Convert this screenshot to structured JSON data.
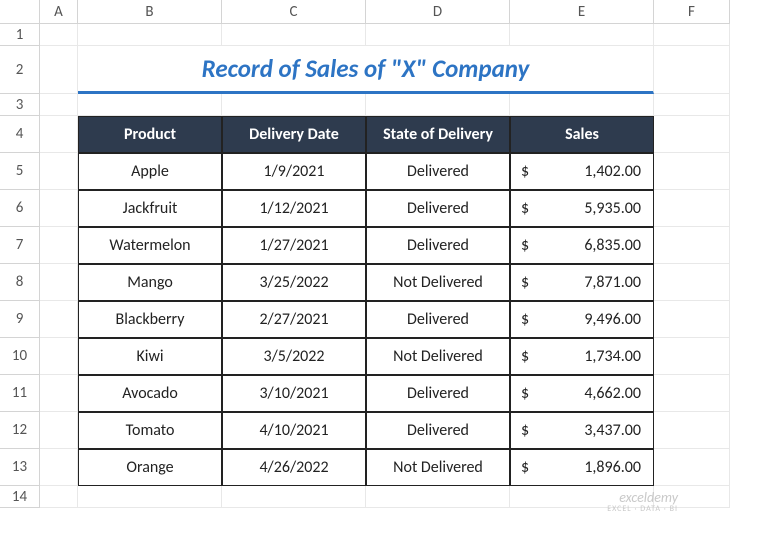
{
  "columns": [
    "A",
    "B",
    "C",
    "D",
    "E",
    "F"
  ],
  "rows": [
    "1",
    "2",
    "3",
    "4",
    "5",
    "6",
    "7",
    "8",
    "9",
    "10",
    "11",
    "12",
    "13",
    "14"
  ],
  "title": "Record of Sales of \"X\" Company",
  "headers": {
    "product": "Product",
    "date": "Delivery Date",
    "state": "State of Delivery",
    "sales": "Sales"
  },
  "currency": "$",
  "data": [
    {
      "product": "Apple",
      "date": "1/9/2021",
      "state": "Delivered",
      "sales": "1,402.00"
    },
    {
      "product": "Jackfruit",
      "date": "1/12/2021",
      "state": "Delivered",
      "sales": "5,935.00"
    },
    {
      "product": "Watermelon",
      "date": "1/27/2021",
      "state": "Delivered",
      "sales": "6,835.00"
    },
    {
      "product": "Mango",
      "date": "3/25/2022",
      "state": "Not Delivered",
      "sales": "7,871.00"
    },
    {
      "product": "Blackberry",
      "date": "2/27/2021",
      "state": "Delivered",
      "sales": "9,496.00"
    },
    {
      "product": "Kiwi",
      "date": "3/5/2022",
      "state": "Not Delivered",
      "sales": "1,734.00"
    },
    {
      "product": "Avocado",
      "date": "3/10/2021",
      "state": "Delivered",
      "sales": "4,662.00"
    },
    {
      "product": "Tomato",
      "date": "4/10/2021",
      "state": "Delivered",
      "sales": "3,437.00"
    },
    {
      "product": "Orange",
      "date": "4/26/2022",
      "state": "Not Delivered",
      "sales": "1,896.00"
    }
  ],
  "watermark": {
    "main": "exceldemy",
    "sub": "EXCEL · DATA · BI"
  },
  "chart_data": {
    "type": "table",
    "title": "Record of Sales of \"X\" Company",
    "columns": [
      "Product",
      "Delivery Date",
      "State of Delivery",
      "Sales"
    ],
    "rows": [
      [
        "Apple",
        "1/9/2021",
        "Delivered",
        1402.0
      ],
      [
        "Jackfruit",
        "1/12/2021",
        "Delivered",
        5935.0
      ],
      [
        "Watermelon",
        "1/27/2021",
        "Delivered",
        6835.0
      ],
      [
        "Mango",
        "3/25/2022",
        "Not Delivered",
        7871.0
      ],
      [
        "Blackberry",
        "2/27/2021",
        "Delivered",
        9496.0
      ],
      [
        "Kiwi",
        "3/5/2022",
        "Not Delivered",
        1734.0
      ],
      [
        "Avocado",
        "3/10/2021",
        "Delivered",
        4662.0
      ],
      [
        "Tomato",
        "4/10/2021",
        "Delivered",
        3437.0
      ],
      [
        "Orange",
        "4/26/2022",
        "Not Delivered",
        1896.0
      ]
    ]
  }
}
